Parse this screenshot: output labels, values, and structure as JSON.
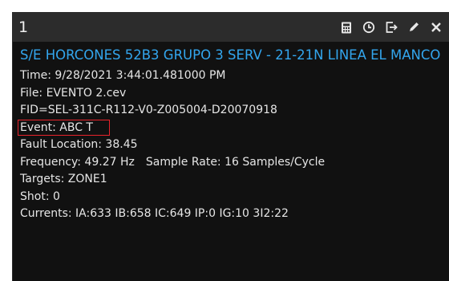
{
  "window": {
    "number": "1"
  },
  "toolbar": {
    "buttons": [
      {
        "icon": "calculator-icon"
      },
      {
        "icon": "clock-icon"
      },
      {
        "icon": "export-icon"
      },
      {
        "icon": "pencil-icon"
      },
      {
        "icon": "close-icon"
      }
    ]
  },
  "event": {
    "title": "S/E HORCONES 52B3 GRUPO 3 SERV - 21-21N LINEA EL MANCO",
    "time": "Time: 9/28/2021 3:44:01.481000 PM",
    "file": "File: EVENTO 2.cev",
    "fid": "FID=SEL-311C-R112-V0-Z005004-D20070918",
    "event_type": "Event: ABC T",
    "fault_location": "Fault Location: 38.45",
    "frequency": "Frequency: 49.27 Hz",
    "sample_rate": "Sample Rate: 16 Samples/Cycle",
    "targets": "Targets: ZONE1",
    "shot": "Shot: 0",
    "currents": "Currents: IA:633 IB:658 IC:649 IP:0 IG:10 3I2:22"
  },
  "colors": {
    "title_blue": "#33a6ee",
    "text": "#e6e6e6",
    "highlight_box": "#e8232b",
    "panel_bg": "#111111",
    "titlebar_bg": "#2c2c2c"
  }
}
